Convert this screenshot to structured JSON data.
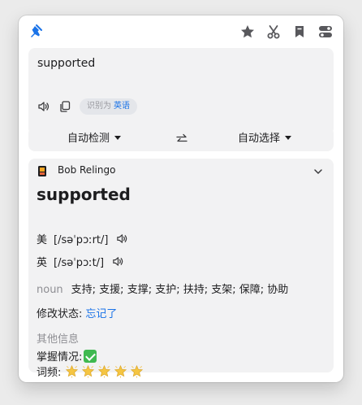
{
  "toolbar": {
    "icons": [
      "pin-icon",
      "star-icon",
      "scissors-icon",
      "bookmark-icon",
      "toggle-icon"
    ],
    "accent": "#1a73e8"
  },
  "input": {
    "text": "supported",
    "detected_prefix": "识别为",
    "detected_lang": "英语"
  },
  "languages": {
    "source": "自动检测",
    "target": "自动选择"
  },
  "result": {
    "service_name": "Bob Relingo",
    "word": "supported",
    "phonetics": [
      {
        "region": "美",
        "ipa": "[/səˈpɔːrt/]"
      },
      {
        "region": "英",
        "ipa": "[/səˈpɔːt/]"
      }
    ],
    "definition": {
      "pos": "noun",
      "meaning": "支持; 支援; 支撑; 支护; 扶持; 支架; 保障; 协助"
    },
    "status_label": "修改状态:",
    "status_link": "忘记了",
    "other_info_title": "其他信息",
    "mastery_label": "掌握情况:",
    "frequency_label": "词频:",
    "frequency_stars": 5
  },
  "colors": {
    "card_bg": "#f2f2f3",
    "link": "#1a73e8",
    "check": "#3fb950",
    "star": "#f5c542"
  }
}
